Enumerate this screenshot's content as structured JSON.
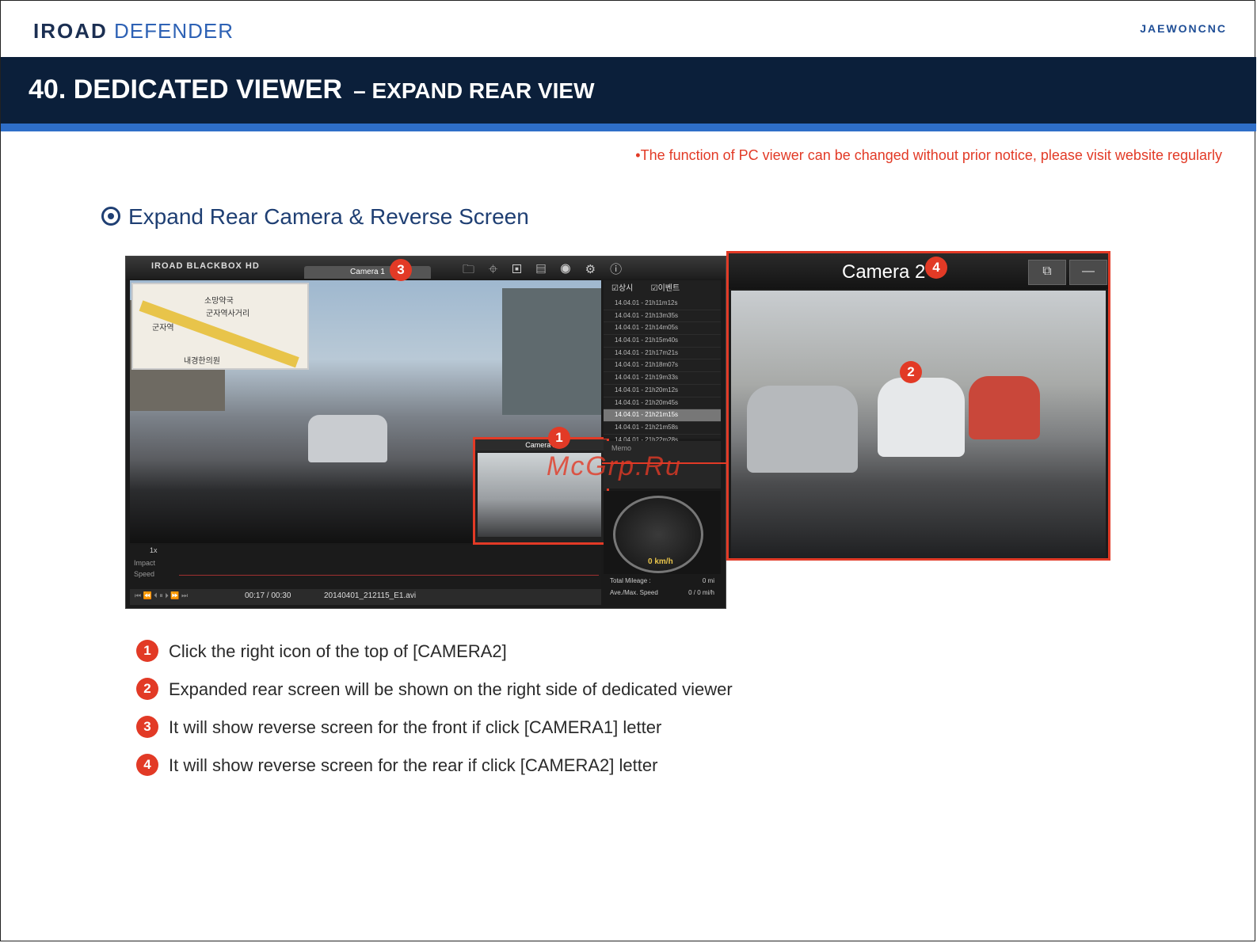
{
  "header": {
    "brand_bold": "IROAD",
    "brand_light": "DEFENDER",
    "company": "JAEWONCNC",
    "title": "40. DEDICATED VIEWER",
    "subtitle": "– EXPAND REAR VIEW"
  },
  "notice": "•The function of PC viewer can be changed without prior notice, please visit website regularly",
  "section_title": "Expand Rear Camera & Reverse Screen",
  "viewer": {
    "logo": "IROAD BLACKBOX HD",
    "camera1_tab": "Camera 1",
    "camera2_label": "Camera 2",
    "list_header_left": "☑상시",
    "list_header_right": "☑이벤트",
    "files": [
      "14.04.01 - 21h11m12s",
      "14.04.01 - 21h13m35s",
      "14.04.01 - 21h14m05s",
      "14.04.01 - 21h15m40s",
      "14.04.01 - 21h17m21s",
      "14.04.01 - 21h18m07s",
      "14.04.01 - 21h19m33s",
      "14.04.01 - 21h20m12s",
      "14.04.01 - 21h20m45s",
      "14.04.01 - 21h21m15s",
      "14.04.01 - 21h21m58s",
      "14.04.01 - 21h22m28s"
    ],
    "selected_file_index": 9,
    "memo_label": "Memo",
    "speed_readout": "0 km/h",
    "total_mileage_label": "Total Mileage :",
    "total_mileage_value": "0 mi",
    "avg_speed_label": "Ave./Max. Speed",
    "avg_speed_value": "0 / 0 mi/h",
    "playback_rate": "1x",
    "impact_label": "Impact",
    "speed_label": "Speed",
    "time": "00:17 / 00:30",
    "filename": "20140401_212115_E1.avi",
    "map_labels": [
      "소망약국",
      "군자역사거리",
      "군자역",
      "내경한의원"
    ]
  },
  "expanded": {
    "camera_label": "Camera 2"
  },
  "watermark": "McGrp.Ru",
  "badges": {
    "b1": "1",
    "b2": "2",
    "b3": "3",
    "b4": "4"
  },
  "steps": [
    {
      "num": "1",
      "text": "Click the right icon of the top of [CAMERA2]"
    },
    {
      "num": "2",
      "text": "Expanded rear screen will be shown on the right side of dedicated viewer"
    },
    {
      "num": "3",
      "text": "It will show reverse screen for the front if click [CAMERA1] letter"
    },
    {
      "num": "4",
      "text": "It will show reverse screen for the rear if click [CAMERA2] letter"
    }
  ],
  "colors": {
    "accent_red": "#e23a26",
    "title_bar": "#0b1f3a",
    "title_accent": "#2e6ec8"
  }
}
